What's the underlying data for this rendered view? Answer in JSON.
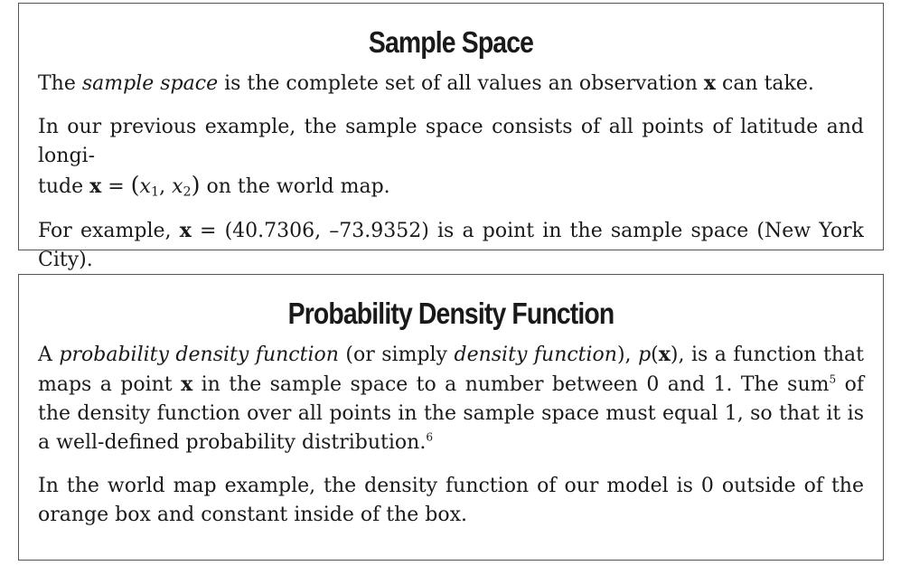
{
  "sample_space": {
    "title": "Sample Space",
    "p1": {
      "t1": "The ",
      "term": "sample space",
      "t2": " is the complete set of all values an observation ",
      "var": "x",
      "t3": " can take."
    },
    "p2": {
      "t1": "In our previous example, the sample space consists of all points of latitude and longi-",
      "t2": "tude ",
      "var": "x",
      "eq": " = ",
      "x1": "x",
      "sub1": "1",
      "comma": ", ",
      "x2": "x",
      "sub2": "2",
      "t3": " on the world map."
    },
    "p3": {
      "t1": "For example, ",
      "var": "x",
      "t2": " = (40.7306, –73.9352) is a point in the sample space (New York City)."
    }
  },
  "pdf": {
    "title": "Probability Density Function",
    "p1": {
      "t1": "A ",
      "term1": "probability density function",
      "t2": " (or simply ",
      "term2": "density function",
      "t3": "), ",
      "func": "p",
      "t4": "(",
      "var": "x",
      "t5": "), is a function that maps a point ",
      "var2": "x",
      "t6": " in the sample space to a number between 0 and 1. The sum",
      "fn5": "5",
      "t7": " of the density function over all points in the sample space must equal 1, so that it is a well-defined probability distribution.",
      "fn6": "6"
    },
    "p2": {
      "t1": "In the world map example, the density function of our model is 0 outside of the orange box and constant inside of the box."
    }
  }
}
